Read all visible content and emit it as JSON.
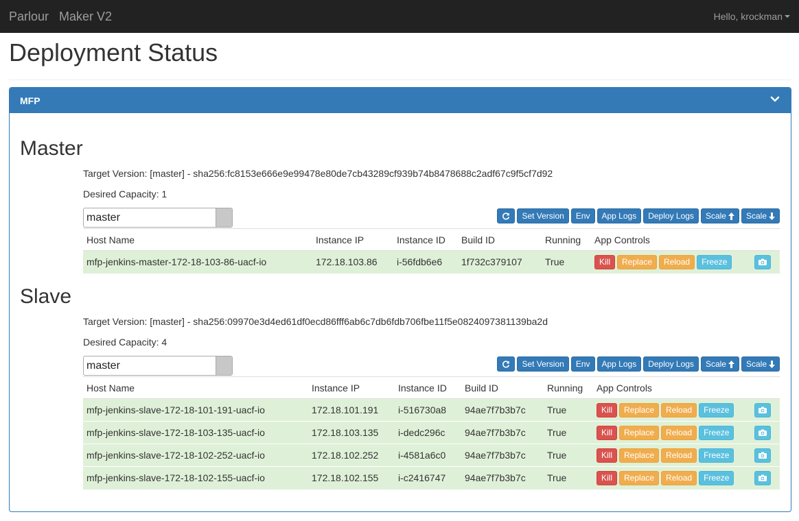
{
  "navbar": {
    "brand": "Parlour",
    "product": "Maker V2",
    "user_greeting": "Hello, krockman"
  },
  "page": {
    "title": "Deployment Status"
  },
  "panel": {
    "title": "MFP"
  },
  "table_headers": [
    "Host Name",
    "Instance IP",
    "Instance ID",
    "Build ID",
    "Running",
    "App Controls"
  ],
  "toolbar": {
    "set_version": "Set Version",
    "env": "Env",
    "app_logs": "App Logs",
    "deploy_logs": "Deploy Logs",
    "scale_up": "Scale",
    "scale_down": "Scale"
  },
  "controls": {
    "kill": "Kill",
    "replace": "Replace",
    "reload": "Reload",
    "freeze": "Freeze"
  },
  "master": {
    "title": "Master",
    "target_version": "Target Version: [master] - sha256:fc8153e666e9e99478e80de7cb43289cf939b74b8478688c2adf67c9f5cf7d92",
    "desired_capacity": "Desired Capacity: 1",
    "select_value": "master",
    "rows": [
      {
        "host": "mfp-jenkins-master-172-18-103-86-uacf-io",
        "ip": "172.18.103.86",
        "id": "i-56fdb6e6",
        "build": "1f732c379107",
        "running": "True"
      }
    ]
  },
  "slave": {
    "title": "Slave",
    "target_version": "Target Version: [master] - sha256:09970e3d4ed61df0ecd86fff6ab6c7db6fdb706fbe11f5e0824097381139ba2d",
    "desired_capacity": "Desired Capacity: 4",
    "select_value": "master",
    "rows": [
      {
        "host": "mfp-jenkins-slave-172-18-101-191-uacf-io",
        "ip": "172.18.101.191",
        "id": "i-516730a8",
        "build": "94ae7f7b3b7c",
        "running": "True"
      },
      {
        "host": "mfp-jenkins-slave-172-18-103-135-uacf-io",
        "ip": "172.18.103.135",
        "id": "i-dedc296c",
        "build": "94ae7f7b3b7c",
        "running": "True"
      },
      {
        "host": "mfp-jenkins-slave-172-18-102-252-uacf-io",
        "ip": "172.18.102.252",
        "id": "i-4581a6c0",
        "build": "94ae7f7b3b7c",
        "running": "True"
      },
      {
        "host": "mfp-jenkins-slave-172-18-102-155-uacf-io",
        "ip": "172.18.102.155",
        "id": "i-c2416747",
        "build": "94ae7f7b3b7c",
        "running": "True"
      }
    ]
  },
  "colors": {
    "primary": "#337ab7",
    "danger": "#d9534f",
    "warning": "#f0ad4e",
    "info": "#5bc0de",
    "success_row": "#dff0d8",
    "navbar": "#222222"
  }
}
